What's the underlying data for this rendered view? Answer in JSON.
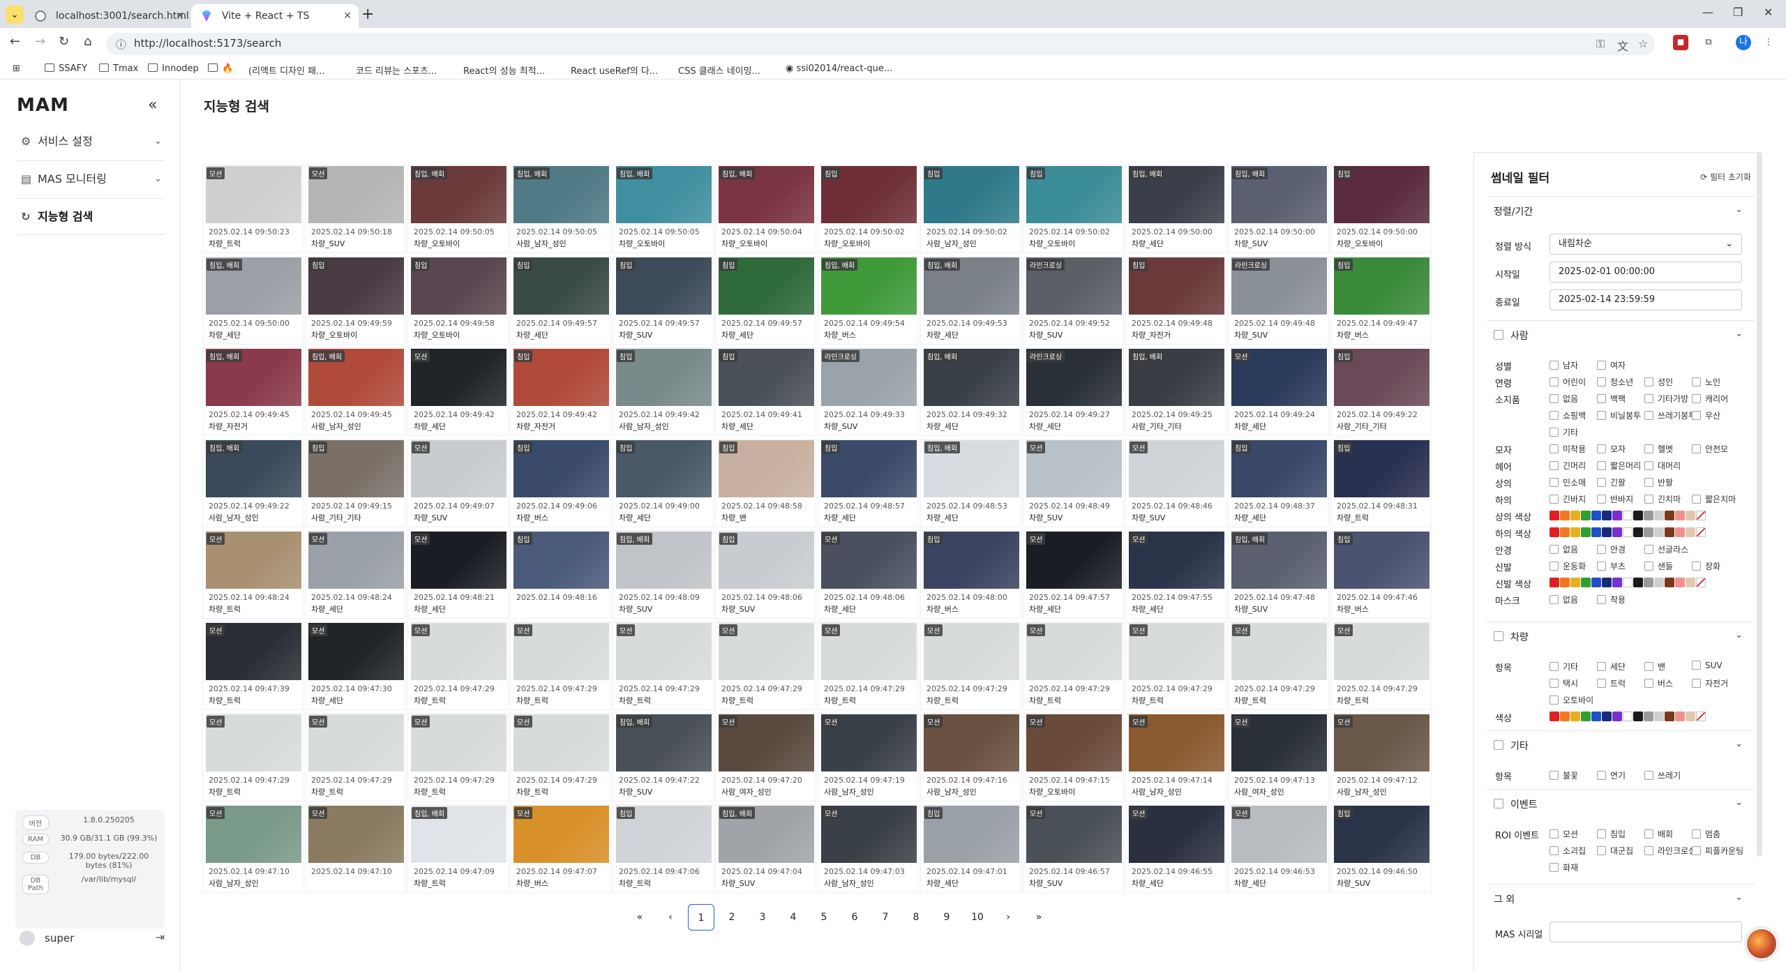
{
  "browser": {
    "tabs": [
      {
        "title": "localhost:3001/search.html",
        "active": false
      },
      {
        "title": "Vite + React + TS",
        "active": true
      }
    ],
    "url": "http://localhost:5173/search",
    "bookmarks": [
      "SSAFY",
      "Tmax",
      "Innodep",
      "",
      "(리액트 디자인 패...",
      "코드 리뷰는 스포츠...",
      "React의 성능 최적...",
      "React useRef의 다...",
      "CSS 클래스 네이밍...",
      "ssi02014/react-que..."
    ]
  },
  "sidebar": {
    "logo": "MAM",
    "items": [
      {
        "label": "서비스 설정",
        "icon": "gear-icon"
      },
      {
        "label": "MAS 모니터링",
        "icon": "monitor-icon"
      },
      {
        "label": "지능형 검색",
        "icon": "refresh-icon",
        "active": true
      }
    ],
    "sysinfo": [
      {
        "key": "버전",
        "value": "1.8.0.250205"
      },
      {
        "key": "RAM",
        "value": "30.9 GB/31.1 GB (99.3%)"
      },
      {
        "key": "DB",
        "value": "179.00 bytes/222.00 bytes (81%)"
      },
      {
        "key": "DB Path",
        "value": "/var/lib/mysql/"
      }
    ],
    "user": "super"
  },
  "page": {
    "title": "지능형 검색"
  },
  "results": [
    {
      "badge": "모션",
      "time": "2025.02.14 09:50:23",
      "label": "차량_트럭",
      "thumb": "#cfcfcf"
    },
    {
      "badge": "모션",
      "time": "2025.02.14 09:50:18",
      "label": "차량_SUV",
      "thumb": "#b5b5b5"
    },
    {
      "badge": "침입, 배회",
      "time": "2025.02.14 09:50:05",
      "label": "차량_오토바이",
      "thumb": "#6b3a3a"
    },
    {
      "badge": "침입, 배회",
      "time": "2025.02.14 09:50:05",
      "label": "사람_남자_성인",
      "thumb": "#4f7a86"
    },
    {
      "badge": "침입, 배회",
      "time": "2025.02.14 09:50:05",
      "label": "차량_오토바이",
      "thumb": "#3f8fa0"
    },
    {
      "badge": "침입, 배회",
      "time": "2025.02.14 09:50:04",
      "label": "차량_오토바이",
      "thumb": "#7a3340"
    },
    {
      "badge": "침입",
      "time": "2025.02.14 09:50:02",
      "label": "차량_오토바이",
      "thumb": "#6e2f36"
    },
    {
      "badge": "침입",
      "time": "2025.02.14 09:50:02",
      "label": "사람_남자_성인",
      "thumb": "#2f7a8a"
    },
    {
      "badge": "침입",
      "time": "2025.02.14 09:50:02",
      "label": "차량_오토바이",
      "thumb": "#3b8c99"
    },
    {
      "badge": "침입, 배회",
      "time": "2025.02.14 09:50:00",
      "label": "차량_세단",
      "thumb": "#3a3f4a"
    },
    {
      "badge": "침입, 배회",
      "time": "2025.02.14 09:50:00",
      "label": "차량_SUV",
      "thumb": "#5a6070"
    },
    {
      "badge": "침입",
      "time": "2025.02.14 09:50:00",
      "label": "차량_오토바이",
      "thumb": "#5a2a40"
    },
    {
      "badge": "침입, 배회",
      "time": "2025.02.14 09:50:00",
      "label": "차량_세단",
      "thumb": "#9aa0a6"
    },
    {
      "badge": "침입",
      "time": "2025.02.14 09:49:59",
      "label": "차량_오토바이",
      "thumb": "#4a3a44"
    },
    {
      "badge": "침입",
      "time": "2025.02.14 09:49:58",
      "label": "차량_오토바이",
      "thumb": "#5a4650"
    },
    {
      "badge": "침입",
      "time": "2025.02.14 09:49:57",
      "label": "차량_세단",
      "thumb": "#3a4a44"
    },
    {
      "badge": "침입",
      "time": "2025.02.14 09:49:57",
      "label": "차량_SUV",
      "thumb": "#3d4a5a"
    },
    {
      "badge": "침입",
      "time": "2025.02.14 09:49:57",
      "label": "차량_세단",
      "thumb": "#2f6a3a"
    },
    {
      "badge": "침입, 배회",
      "time": "2025.02.14 09:49:54",
      "label": "차량_버스",
      "thumb": "#3f9a3a"
    },
    {
      "badge": "침입, 배회",
      "time": "2025.02.14 09:49:53",
      "label": "차량_세단",
      "thumb": "#7a8088"
    },
    {
      "badge": "라인크로싱",
      "time": "2025.02.14 09:49:52",
      "label": "차량_SUV",
      "thumb": "#5a5f68"
    },
    {
      "badge": "침입",
      "time": "2025.02.14 09:49:48",
      "label": "차량_자전거",
      "thumb": "#6a3a3a"
    },
    {
      "badge": "라인크로싱",
      "time": "2025.02.14 09:49:48",
      "label": "차량_SUV",
      "thumb": "#8a9098"
    },
    {
      "badge": "침입",
      "time": "2025.02.14 09:49:47",
      "label": "차량_버스",
      "thumb": "#3a8a3a"
    },
    {
      "badge": "침입, 배회",
      "time": "2025.02.14 09:49:45",
      "label": "차량_자전거",
      "thumb": "#8a3a4a"
    },
    {
      "badge": "침입, 배회",
      "time": "2025.02.14 09:49:45",
      "label": "사람_남자_성인",
      "thumb": "#b04a3a"
    },
    {
      "badge": "모션",
      "time": "2025.02.14 09:49:42",
      "label": "차량_세단",
      "thumb": "#202428"
    },
    {
      "badge": "침입",
      "time": "2025.02.14 09:49:42",
      "label": "차량_자전거",
      "thumb": "#b04a3a"
    },
    {
      "badge": "침입",
      "time": "2025.02.14 09:49:42",
      "label": "사람_남자_성인",
      "thumb": "#7a8a8a"
    },
    {
      "badge": "침입",
      "time": "2025.02.14 09:49:41",
      "label": "차량_세단",
      "thumb": "#4a5058"
    },
    {
      "badge": "라인크로싱",
      "time": "2025.02.14 09:49:33",
      "label": "차량_SUV",
      "thumb": "#9aa2aa"
    },
    {
      "badge": "침입, 배회",
      "time": "2025.02.14 09:49:32",
      "label": "차량_세단",
      "thumb": "#3a4048"
    },
    {
      "badge": "라인크로싱",
      "time": "2025.02.14 09:49:27",
      "label": "차량_세단",
      "thumb": "#2a3038"
    },
    {
      "badge": "침입, 배회",
      "time": "2025.02.14 09:49:25",
      "label": "사람_기타_기타",
      "thumb": "#3a3e44"
    },
    {
      "badge": "모션",
      "time": "2025.02.14 09:49:24",
      "label": "차량_세단",
      "thumb": "#2a3a5a"
    },
    {
      "badge": "침입",
      "time": "2025.02.14 09:49:22",
      "label": "사람_기타_기타",
      "thumb": "#6a4a58"
    },
    {
      "badge": "침입, 배회",
      "time": "2025.02.14 09:49:22",
      "label": "사람_남자_성인",
      "thumb": "#3a4a5a"
    },
    {
      "badge": "침입",
      "time": "2025.02.14 09:49:15",
      "label": "사람_기타_기타",
      "thumb": "#7a7068"
    },
    {
      "badge": "모션",
      "time": "2025.02.14 09:49:07",
      "label": "차량_SUV",
      "thumb": "#c8ccd0"
    },
    {
      "badge": "침입",
      "time": "2025.02.14 09:49:06",
      "label": "차량_버스",
      "thumb": "#3a4a6a"
    },
    {
      "badge": "침입",
      "time": "2025.02.14 09:49:00",
      "label": "차량_세단",
      "thumb": "#4a5868"
    },
    {
      "badge": "침입",
      "time": "2025.02.14 09:48:58",
      "label": "차량_밴",
      "thumb": "#c8b0a0"
    },
    {
      "badge": "침입",
      "time": "2025.02.14 09:48:57",
      "label": "차량_세단",
      "thumb": "#3a4a68"
    },
    {
      "badge": "침입, 배회",
      "time": "2025.02.14 09:48:53",
      "label": "차량_세단",
      "thumb": "#d8dce0"
    },
    {
      "badge": "모션",
      "time": "2025.02.14 09:48:49",
      "label": "차량_SUV",
      "thumb": "#b8c0c8"
    },
    {
      "badge": "모션",
      "time": "2025.02.14 09:48:46",
      "label": "차량_SUV",
      "thumb": "#d0d4d8"
    },
    {
      "badge": "침입",
      "time": "2025.02.14 09:48:37",
      "label": "차량_세단",
      "thumb": "#3a4868"
    },
    {
      "badge": "침입",
      "time": "2025.02.14 09:48:31",
      "label": "차량_트럭",
      "thumb": "#2a3050"
    },
    {
      "badge": "모션",
      "time": "2025.02.14 09:48:24",
      "label": "차량_트럭",
      "thumb": "#a89070"
    },
    {
      "badge": "모션",
      "time": "2025.02.14 09:48:24",
      "label": "차량_세단",
      "thumb": "#9aa0a8"
    },
    {
      "badge": "모션",
      "time": "2025.02.14 09:48:21",
      "label": "차량_세단",
      "thumb": "#1a1e24"
    },
    {
      "badge": "침입",
      "time": "2025.02.14 09:48:16",
      "label": "",
      "thumb": "#4a5a7a"
    },
    {
      "badge": "침입, 배회",
      "time": "2025.02.14 09:48:09",
      "label": "차량_SUV",
      "thumb": "#c0c4c8"
    },
    {
      "badge": "침입",
      "time": "2025.02.14 09:48:06",
      "label": "차량_SUV",
      "thumb": "#c8ccd0"
    },
    {
      "badge": "모션",
      "time": "2025.02.14 09:48:06",
      "label": "차량_세단",
      "thumb": "#4a5060"
    },
    {
      "badge": "침입",
      "time": "2025.02.14 09:48:00",
      "label": "차량_버스",
      "thumb": "#3a4460"
    },
    {
      "badge": "모션",
      "time": "2025.02.14 09:47:57",
      "label": "차량_세단",
      "thumb": "#1a1e24"
    },
    {
      "badge": "모션",
      "time": "2025.02.14 09:47:55",
      "label": "차량_세단",
      "thumb": "#2a3448"
    },
    {
      "badge": "침입, 배회",
      "time": "2025.02.14 09:47:48",
      "label": "차량_SUV",
      "thumb": "#5a6070"
    },
    {
      "badge": "침입",
      "time": "2025.02.14 09:47:46",
      "label": "차량_버스",
      "thumb": "#4a5470"
    },
    {
      "badge": "모션",
      "time": "2025.02.14 09:47:39",
      "label": "차량_트럭",
      "thumb": "#2a2e34"
    },
    {
      "badge": "모션",
      "time": "2025.02.14 09:47:30",
      "label": "차량_세단",
      "thumb": "#202428"
    },
    {
      "badge": "모션",
      "time": "2025.02.14 09:47:29",
      "label": "차량_트럭",
      "thumb": "#d8dcd8"
    },
    {
      "badge": "모션",
      "time": "2025.02.14 09:47:29",
      "label": "차량_트럭",
      "thumb": "#d8dcd8"
    },
    {
      "badge": "모션",
      "time": "2025.02.14 09:47:29",
      "label": "차량_트럭",
      "thumb": "#d8dcd8"
    },
    {
      "badge": "모션",
      "time": "2025.02.14 09:47:29",
      "label": "차량_트럭",
      "thumb": "#d8dcd8"
    },
    {
      "badge": "모션",
      "time": "2025.02.14 09:47:29",
      "label": "차량_트럭",
      "thumb": "#d8dcd8"
    },
    {
      "badge": "모션",
      "time": "2025.02.14 09:47:29",
      "label": "차량_트럭",
      "thumb": "#d8dcd8"
    },
    {
      "badge": "모션",
      "time": "2025.02.14 09:47:29",
      "label": "차량_트럭",
      "thumb": "#d8dcd8"
    },
    {
      "badge": "모션",
      "time": "2025.02.14 09:47:29",
      "label": "차량_트럭",
      "thumb": "#d8dcd8"
    },
    {
      "badge": "모션",
      "time": "2025.02.14 09:47:29",
      "label": "차량_트럭",
      "thumb": "#d8dcd8"
    },
    {
      "badge": "모션",
      "time": "2025.02.14 09:47:29",
      "label": "차량_트럭",
      "thumb": "#d8dcd8"
    },
    {
      "badge": "모션",
      "time": "2025.02.14 09:47:29",
      "label": "차량_트럭",
      "thumb": "#d8dcd8"
    },
    {
      "badge": "모션",
      "time": "2025.02.14 09:47:29",
      "label": "차량_트럭",
      "thumb": "#d8dcd8"
    },
    {
      "badge": "모션",
      "time": "2025.02.14 09:47:29",
      "label": "차량_트럭",
      "thumb": "#d8dcd8"
    },
    {
      "badge": "모션",
      "time": "2025.02.14 09:47:29",
      "label": "차량_트럭",
      "thumb": "#d8dcd8"
    },
    {
      "badge": "침입, 배회",
      "time": "2025.02.14 09:47:22",
      "label": "차량_SUV",
      "thumb": "#4a5058"
    },
    {
      "badge": "모션",
      "time": "2025.02.14 09:47:20",
      "label": "사람_여자_성인",
      "thumb": "#5a4a40"
    },
    {
      "badge": "모션",
      "time": "2025.02.14 09:47:19",
      "label": "사람_남자_성인",
      "thumb": "#3a4048"
    },
    {
      "badge": "모션",
      "time": "2025.02.14 09:47:16",
      "label": "사람_남자_성인",
      "thumb": "#6a5040"
    },
    {
      "badge": "모션",
      "time": "2025.02.14 09:47:15",
      "label": "차량_오토바이",
      "thumb": "#6a4a3a"
    },
    {
      "badge": "모션",
      "time": "2025.02.14 09:47:14",
      "label": "사람_남자_성인",
      "thumb": "#8a5a30"
    },
    {
      "badge": "모션",
      "time": "2025.02.14 09:47:13",
      "label": "사람_여자_성인",
      "thumb": "#2a3038"
    },
    {
      "badge": "모션",
      "time": "2025.02.14 09:47:12",
      "label": "사람_남자_성인",
      "thumb": "#6a5848"
    },
    {
      "badge": "모션",
      "time": "2025.02.14 09:47:10",
      "label": "사람_남자_성인",
      "thumb": "#7a9a8a"
    },
    {
      "badge": "모션",
      "time": "2025.02.14 09:47:10",
      "label": "",
      "thumb": "#8a7a60"
    },
    {
      "badge": "침입, 배회",
      "time": "2025.02.14 09:47:09",
      "label": "차량_트럭",
      "thumb": "#e0e4e8"
    },
    {
      "badge": "모션",
      "time": "2025.02.14 09:47:07",
      "label": "차량_버스",
      "thumb": "#d8902a"
    },
    {
      "badge": "침입",
      "time": "2025.02.14 09:47:06",
      "label": "차량_트럭",
      "thumb": "#d0d4d8"
    },
    {
      "badge": "침입, 배회",
      "time": "2025.02.14 09:47:04",
      "label": "차량_SUV",
      "thumb": "#a0a4a8"
    },
    {
      "badge": "모션",
      "time": "2025.02.14 09:47:03",
      "label": "사람_남자_성인",
      "thumb": "#3a4048"
    },
    {
      "badge": "침입",
      "time": "2025.02.14 09:47:01",
      "label": "차량_세단",
      "thumb": "#9aa0a8"
    },
    {
      "badge": "모션",
      "time": "2025.02.14 09:46:57",
      "label": "차량_SUV",
      "thumb": "#4a5058"
    },
    {
      "badge": "모션",
      "time": "2025.02.14 09:46:55",
      "label": "차량_세단",
      "thumb": "#2a3040"
    },
    {
      "badge": "모션",
      "time": "2025.02.14 09:46:53",
      "label": "차량_세단",
      "thumb": "#b8bcc0"
    },
    {
      "badge": "침입",
      "time": "2025.02.14 09:46:50",
      "label": "차량_SUV",
      "thumb": "#2a3448"
    }
  ],
  "pagination": {
    "first": "«",
    "prev": "‹",
    "pages": [
      "1",
      "2",
      "3",
      "4",
      "5",
      "6",
      "7",
      "8",
      "9",
      "10"
    ],
    "active": "1",
    "next": "›",
    "last": "»"
  },
  "filter": {
    "title": "썸네일 필터",
    "reset": "필터 초기화",
    "sort_section": "정렬/기간",
    "sort_label": "정렬 방식",
    "sort_value": "내림차순",
    "start_label": "시작일",
    "start_value": "2025-02-01 00:00:00",
    "end_label": "종료일",
    "end_value": "2025-02-14 23:59:59",
    "person_section": "사람",
    "person_rows": [
      {
        "label": "성별",
        "options": [
          "남자",
          "여자"
        ]
      },
      {
        "label": "연령",
        "options": [
          "어린이",
          "청소년",
          "성인",
          "노인"
        ]
      },
      {
        "label": "소지품",
        "options": [
          "없음",
          "백팩",
          "기타가방",
          "캐리어",
          "쇼핑백",
          "비닐봉투",
          "쓰레기봉투",
          "우산",
          "기타"
        ]
      },
      {
        "label": "모자",
        "options": [
          "미착용",
          "모자",
          "헬멧",
          "안전모"
        ]
      },
      {
        "label": "헤어",
        "options": [
          "긴머리",
          "짧은머리",
          "대머리"
        ]
      },
      {
        "label": "상의",
        "options": [
          "민소매",
          "긴팔",
          "반팔"
        ]
      },
      {
        "label": "하의",
        "options": [
          "긴바지",
          "반바지",
          "긴치마",
          "짧은치마"
        ]
      },
      {
        "label": "상의 색상",
        "colors": true
      },
      {
        "label": "하의 색상",
        "colors": true
      },
      {
        "label": "안경",
        "options": [
          "없음",
          "안경",
          "선글라스"
        ]
      },
      {
        "label": "신발",
        "options": [
          "운동화",
          "부츠",
          "샌들",
          "장화"
        ]
      },
      {
        "label": "신발 색상",
        "colors": true
      },
      {
        "label": "마스크",
        "options": [
          "없음",
          "착용"
        ]
      }
    ],
    "vehicle_section": "차량",
    "vehicle_rows": [
      {
        "label": "항목",
        "options": [
          "기타",
          "세단",
          "밴",
          "SUV",
          "택시",
          "트럭",
          "버스",
          "자전거",
          "오토바이"
        ]
      },
      {
        "label": "색상",
        "colors": true
      }
    ],
    "etc_section": "기타",
    "etc_rows": [
      {
        "label": "항목",
        "options": [
          "불꽃",
          "연기",
          "쓰레기"
        ]
      }
    ],
    "event_section": "이벤트",
    "event_rows": [
      {
        "label": "ROI 이벤트",
        "options": [
          "모션",
          "침입",
          "배회",
          "멈춤",
          "소괴집",
          "대군집",
          "라인크로싱",
          "피플카운팅",
          "화재"
        ]
      }
    ],
    "other_section": "그 외",
    "mas_serial_label": "MAS 시리얼",
    "mas_serial_value": "",
    "swatches": [
      "#e02020",
      "#f07820",
      "#e8b020",
      "#30a030",
      "#2050c8",
      "#1a2a7a",
      "#7a30d0",
      "#ffffff",
      "#1a1a1a",
      "#9a9a9a",
      "#d0d0d0",
      "#7a3a1a",
      "#f09090",
      "#e0c8b0",
      "none"
    ]
  }
}
